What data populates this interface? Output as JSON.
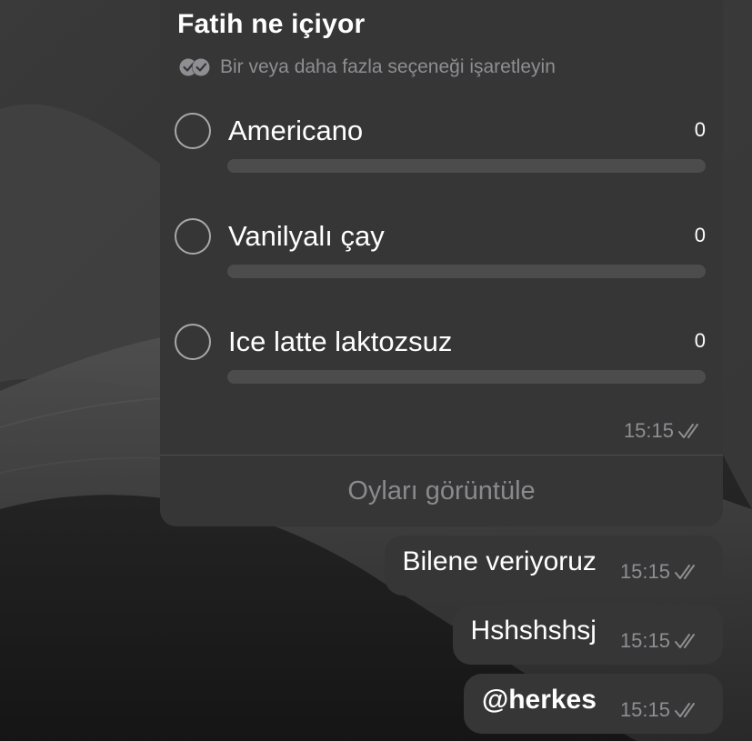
{
  "poll": {
    "title": "Fatih ne içiyor",
    "subtitle": "Bir veya daha fazla seçeneği işaretleyin",
    "options": [
      {
        "label": "Americano",
        "count": "0",
        "fraction": 0
      },
      {
        "label": "Vanilyalı çay",
        "count": "0",
        "fraction": 0
      },
      {
        "label": "Ice latte laktozsuz",
        "count": "0",
        "fraction": 0
      }
    ],
    "time": "15:15",
    "view_votes_label": "Oyları görüntüle"
  },
  "messages": [
    {
      "text": "Bilene veriyoruz",
      "time": "15:15"
    },
    {
      "text": "Hshshshsj",
      "time": "15:15"
    },
    {
      "text": "@herkes",
      "time": "15:15"
    }
  ],
  "icons": {
    "multi_select": "double-check-circle-icon",
    "read_status": "double-check-icon"
  },
  "colors": {
    "bubble": "#363636",
    "secondary_text": "#8e8e93",
    "bar_track": "#4c4c4c"
  }
}
